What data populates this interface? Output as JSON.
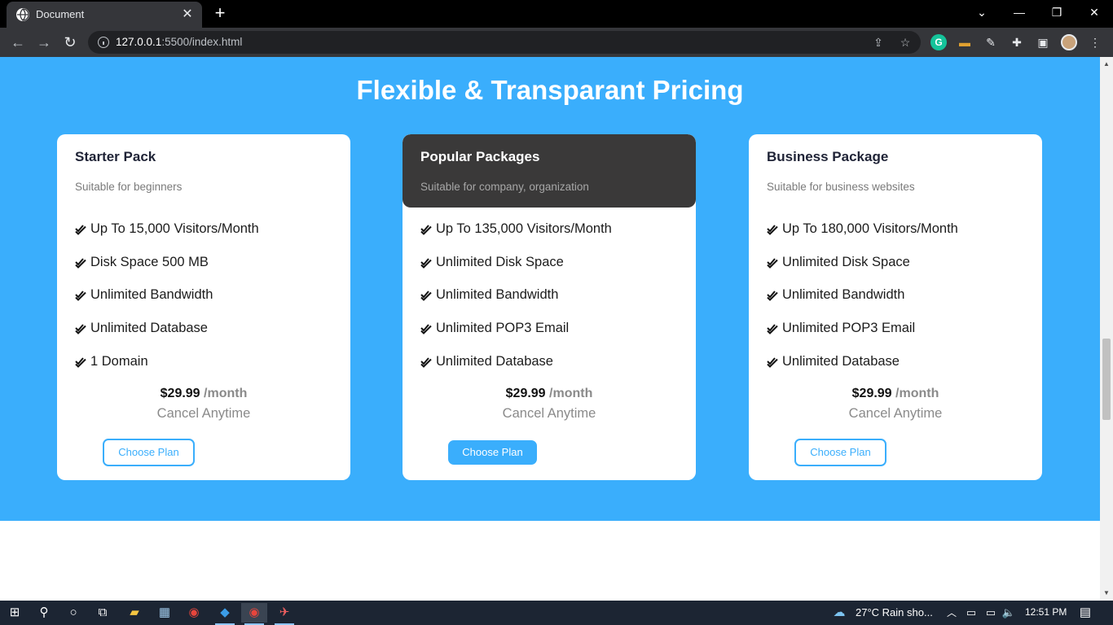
{
  "browser": {
    "tab_title": "Document",
    "url_host": "127.0.0.1",
    "url_rest": ":5500/index.html"
  },
  "page": {
    "heading": "Flexible & Transparant Pricing",
    "accent_color": "#3aaefc",
    "plans": [
      {
        "name": "Starter Pack",
        "description": "Suitable for beginners",
        "features": [
          "Up To 15,000 Visitors/Month",
          "Disk Space 500 MB",
          "Unlimited Bandwidth",
          "Unlimited Database",
          "1 Domain"
        ],
        "price": "$29.99",
        "period": "/month",
        "note": "Cancel Anytime",
        "button": "Choose Plan"
      },
      {
        "name": "Popular Packages",
        "description": "Suitable for company, organization",
        "features": [
          "Up To 135,000 Visitors/Month",
          "Unlimited Disk Space",
          "Unlimited Bandwidth",
          "Unlimited POP3 Email",
          "Unlimited Database"
        ],
        "price": "$29.99",
        "period": "/month",
        "note": "Cancel Anytime",
        "button": "Choose Plan"
      },
      {
        "name": "Business Package",
        "description": "Suitable for business websites",
        "features": [
          "Up To 180,000 Visitors/Month",
          "Unlimited Disk Space",
          "Unlimited Bandwidth",
          "Unlimited POP3 Email",
          "Unlimited Database"
        ],
        "price": "$29.99",
        "period": "/month",
        "note": "Cancel Anytime",
        "button": "Choose Plan"
      }
    ]
  },
  "taskbar": {
    "weather": "27°C  Rain sho...",
    "time": "12:51 PM"
  }
}
